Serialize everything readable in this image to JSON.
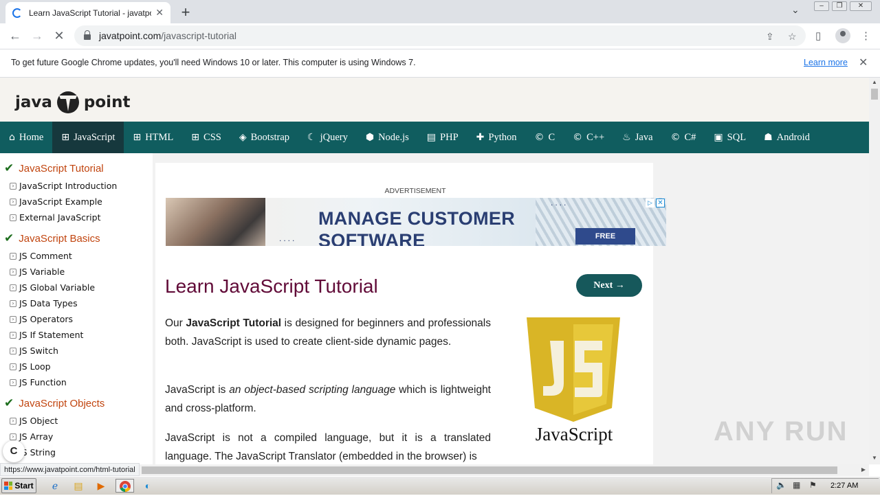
{
  "browser": {
    "tab_title": "Learn JavaScript Tutorial - javatpoint",
    "tab_close": "✕",
    "new_tab": "+",
    "url_domain": "javatpoint.com",
    "url_path": "/javascript-tutorial"
  },
  "infobar": {
    "message": "To get future Google Chrome updates, you'll need Windows 10 or later. This computer is using Windows 7.",
    "link": "Learn more",
    "close": "✕"
  },
  "site": {
    "logo_left": "java",
    "logo_right": "point"
  },
  "nav": [
    {
      "label": "Home",
      "icon": "⌂"
    },
    {
      "label": "JavaScript",
      "icon": "⊞"
    },
    {
      "label": "HTML",
      "icon": "⊞"
    },
    {
      "label": "CSS",
      "icon": "⊞"
    },
    {
      "label": "Bootstrap",
      "icon": "◈"
    },
    {
      "label": "jQuery",
      "icon": "☾"
    },
    {
      "label": "Node.js",
      "icon": "⬢"
    },
    {
      "label": "PHP",
      "icon": "▤"
    },
    {
      "label": "Python",
      "icon": "✚"
    },
    {
      "label": "C",
      "icon": "©"
    },
    {
      "label": "C++",
      "icon": "©"
    },
    {
      "label": "Java",
      "icon": "♨"
    },
    {
      "label": "C#",
      "icon": "©"
    },
    {
      "label": "SQL",
      "icon": "▣"
    },
    {
      "label": "Android",
      "icon": "☗"
    }
  ],
  "sidebar": {
    "groups": [
      {
        "heading": "JavaScript Tutorial",
        "items": [
          "JavaScript Introduction",
          "JavaScript Example",
          "External JavaScript"
        ]
      },
      {
        "heading": "JavaScript Basics",
        "items": [
          "JS Comment",
          "JS Variable",
          "JS Global Variable",
          "JS Data Types",
          "JS Operators",
          "JS If Statement",
          "JS Switch",
          "JS Loop",
          "JS Function"
        ]
      },
      {
        "heading": "JavaScript Objects",
        "items": [
          "JS Object",
          "JS Array",
          "JS String"
        ]
      }
    ]
  },
  "ad": {
    "label": "ADVERTISEMENT",
    "headline_1": "MANAGE CUSTOMER",
    "headline_2": "SOFTWARE",
    "cta": "FREE",
    "close": "✕",
    "info": "▷"
  },
  "main": {
    "title": "Learn JavaScript Tutorial",
    "next": "Next →",
    "p1_prefix": "Our",
    "p1_bold": "JavaScript Tutorial",
    "p1_suffix": "is designed for beginners and professionals both. JavaScript is used to create client-side dynamic pages.",
    "p2_prefix": "JavaScript is",
    "p2_italic": "an object-based scripting language",
    "p2_suffix": "which is lightweight and cross-platform.",
    "p3": "JavaScript is not a compiled language, but it is a translated language. The JavaScript Translator (embedded in the browser) is",
    "logo_caption": "JavaScript"
  },
  "status": {
    "hover_url": "https://www.javatpoint.com/html-tutorial",
    "bubble": "C"
  },
  "watermark": "ANY RUN",
  "taskbar": {
    "start": "Start",
    "clock": "2:27 AM"
  },
  "colors": {
    "nav_bg": "#105d5f",
    "nav_active": "#16383d",
    "title": "#610b38",
    "sidebar_heading": "#c1440e",
    "next_btn": "#16585b"
  }
}
